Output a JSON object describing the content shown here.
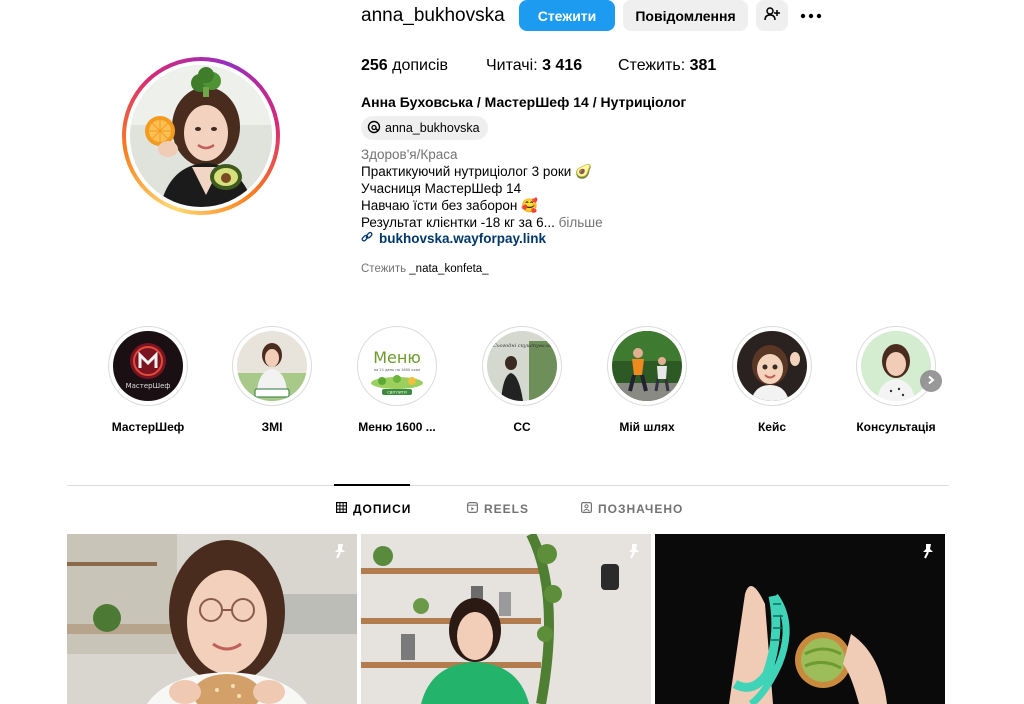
{
  "profile": {
    "username": "anna_bukhovska",
    "follow_label": "Стежити",
    "message_label": "Повідомлення",
    "stats": {
      "posts_count": "256",
      "posts_label": " дописів",
      "followers_label": "Читачі: ",
      "followers_count": "3 416",
      "following_label": "Стежить: ",
      "following_count": "381"
    },
    "full_name": "Анна Буховська / МастерШеф 14 / Нутриціолог",
    "threads_handle": "anna_bukhovska",
    "category": "Здоров'я/Краса",
    "bio": [
      "Практикуючий нутриціолог 3 роки 🥑",
      "Учасниця МастерШеф 14",
      "Навчаю їсти без заборон 🥰",
      "Результат клієнтки -18 кг за 6..."
    ],
    "more_label": " більше",
    "link": "bukhovska.wayforpay.link",
    "followed_by_label": "Стежить ",
    "followed_by_user": "_nata_konfeta_"
  },
  "highlights": [
    {
      "label": "МастерШеф"
    },
    {
      "label": "ЗМІ"
    },
    {
      "label": "Меню 1600 ...",
      "cover_text": "Меню",
      "cover_sub": "на 21 день по 1600 ккал",
      "cover_badge": "СВІТЛИТИ"
    },
    {
      "label": "СС",
      "cover_text": "Сьогодні скуштувала"
    },
    {
      "label": "Мій шлях"
    },
    {
      "label": "Кейс"
    },
    {
      "label": "Консультація"
    }
  ],
  "highlight_cover_masterchef": "МастерШеф",
  "tabs": {
    "posts": "ДОПИСИ",
    "reels": "REELS",
    "tagged": "ПОЗНАЧЕНО"
  },
  "colors": {
    "follow_button": "#1d9bf0",
    "link": "#00376b",
    "secondary_text": "#737373"
  },
  "icons": [
    "threads-icon",
    "add-person-icon",
    "more-icon",
    "link-icon",
    "grid-icon",
    "reels-icon",
    "tagged-icon",
    "pin-icon",
    "chevron-right-icon"
  ]
}
